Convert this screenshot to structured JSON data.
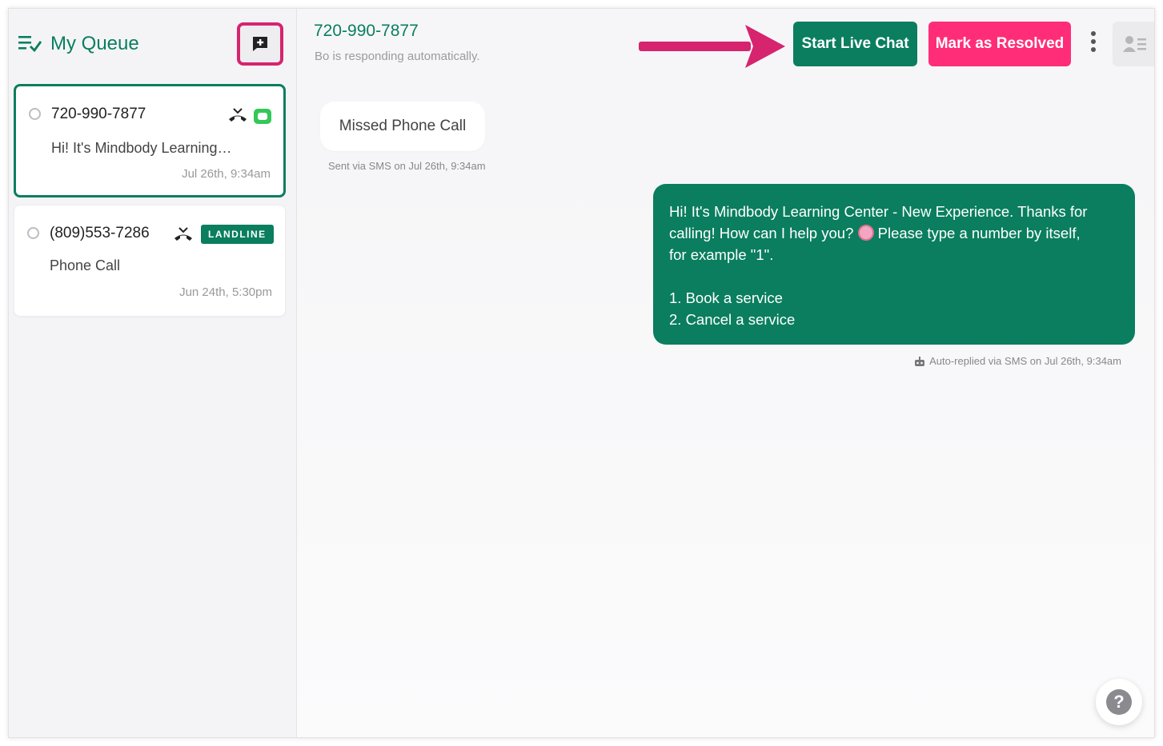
{
  "sidebar": {
    "title": "My Queue",
    "conversations": [
      {
        "phone": "720-990-7877",
        "preview": "Hi! It's Mindbody Learning…",
        "time": "Jul 26th, 9:34am",
        "icons": [
          "missed-call-icon",
          "sms-icon"
        ]
      },
      {
        "phone": "(809)553-7286",
        "preview": "Phone Call",
        "time": "Jun 24th, 5:30pm",
        "badge": "LANDLINE",
        "icons": [
          "missed-call-icon"
        ]
      }
    ]
  },
  "header": {
    "phone": "720-990-7877",
    "subtitle": "Bo is responding automatically.",
    "start_live_chat": "Start Live Chat",
    "mark_resolved": "Mark as Resolved"
  },
  "messages": {
    "incoming": {
      "text": "Missed Phone Call",
      "meta": "Sent via SMS on Jul 26th, 9:34am"
    },
    "outgoing": {
      "line1": "Hi! It's Mindbody Learning Center - New Experience. Thanks for",
      "line2a": "calling! How can I help you?",
      "line2b": "Please type a number by itself,",
      "line3": "for example \"1\".",
      "option1": "1. Book a service",
      "option2": "2. Cancel a service",
      "meta": "Auto-replied via SMS on Jul 26th, 9:34am"
    }
  },
  "help": {
    "label": "?"
  },
  "colors": {
    "brand_green": "#0a7e5f",
    "resolve_pink": "#ff2d78",
    "highlight_magenta": "#d6246e",
    "sms_green": "#34c759"
  }
}
